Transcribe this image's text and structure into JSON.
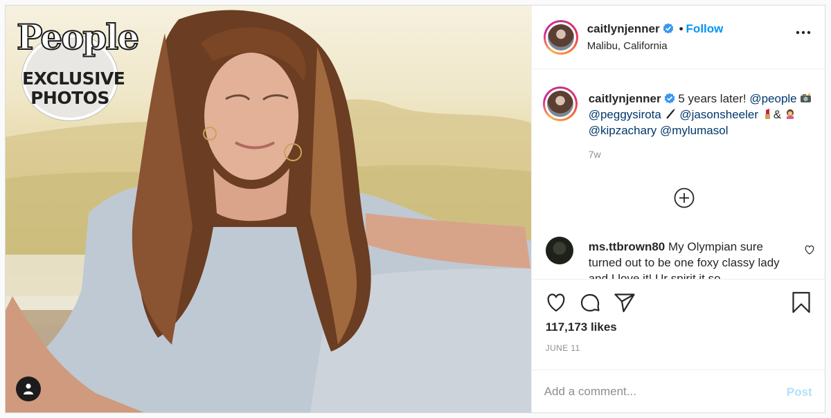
{
  "photo": {
    "badge_brand": "People",
    "badge_line1": "EXCLUSIVE",
    "badge_line2": "PHOTOS",
    "tag_icon": "user-icon"
  },
  "header": {
    "username": "caitlynjenner",
    "verified_icon": "verified-badge-icon",
    "separator": "•",
    "follow_label": "Follow",
    "location": "Malibu, California",
    "more_icon": "more-options-icon"
  },
  "caption": {
    "username": "caitlynjenner",
    "text_start": "5 years later!",
    "mention1": "@people",
    "mention2": "@peggysirota",
    "mention3": "@jasonsheeler",
    "amp": "&",
    "mention4": "@kipzachary",
    "mention5": "@mylumasol",
    "age": "7w"
  },
  "comment": {
    "username": "ms.ttbrown80",
    "text": "My Olympian sure turned out to be one foxy classy lady and I love it! Ur spirit it so"
  },
  "actions": {
    "like_icon": "heart-icon",
    "comment_icon": "comment-icon",
    "share_icon": "share-icon",
    "save_icon": "bookmark-icon"
  },
  "likes": "117,173 likes",
  "date": "JUNE 11",
  "add_comment": {
    "placeholder": "Add a comment...",
    "post_label": "Post"
  },
  "colors": {
    "link": "#00376b",
    "follow": "#0095f6",
    "post_disabled": "#b2dffc",
    "muted": "#8e8e8e"
  }
}
